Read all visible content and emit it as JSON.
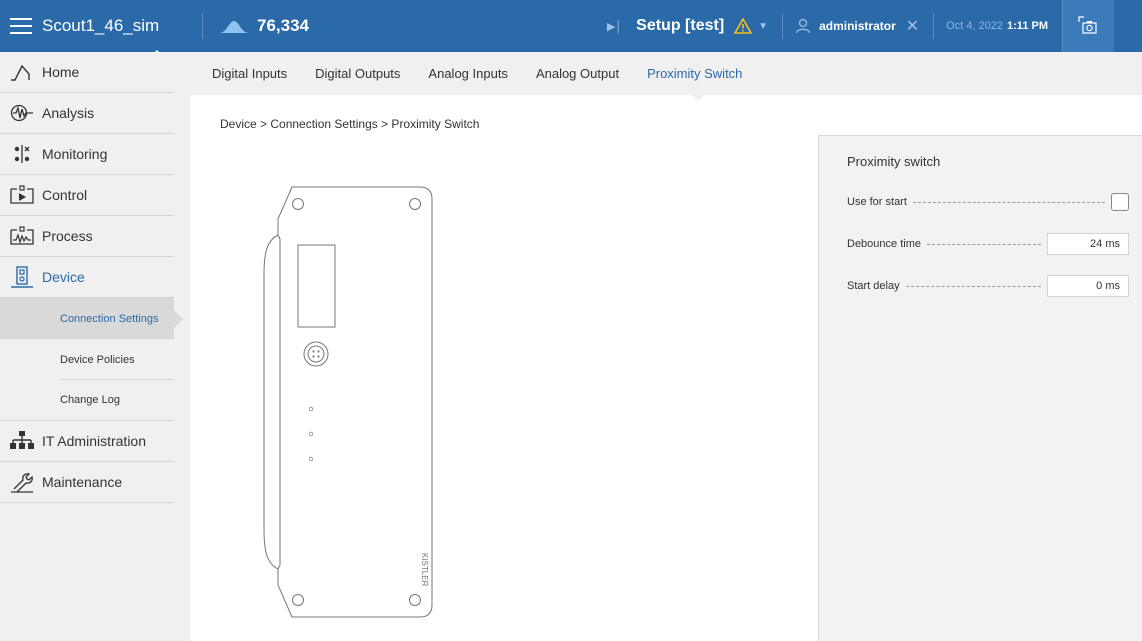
{
  "topbar": {
    "app_name": "Scout1_46_sim",
    "count": "76,334",
    "setup": "Setup [test]",
    "user": "administrator",
    "date": "Oct 4, 2022",
    "time": "1:11 PM",
    "colors": {
      "bar": "#2a6aa8",
      "warning": "#f5c218"
    }
  },
  "sidebar": {
    "items": [
      {
        "label": "Home",
        "icon": "home-icon"
      },
      {
        "label": "Analysis",
        "icon": "analysis-icon"
      },
      {
        "label": "Monitoring",
        "icon": "monitoring-icon"
      },
      {
        "label": "Control",
        "icon": "control-icon"
      },
      {
        "label": "Process",
        "icon": "process-icon"
      },
      {
        "label": "Device",
        "icon": "device-icon"
      },
      {
        "label": "IT Administration",
        "icon": "network-icon"
      },
      {
        "label": "Maintenance",
        "icon": "wrench-icon"
      }
    ],
    "device_sub": [
      "Connection Settings",
      "Device Policies",
      "Change Log"
    ],
    "active_item": "Device",
    "selected_sub": "Connection Settings"
  },
  "tabs": [
    "Digital Inputs",
    "Digital Outputs",
    "Analog Inputs",
    "Analog Output",
    "Proximity Switch"
  ],
  "active_tab": "Proximity Switch",
  "breadcrumb": "Device > Connection Settings > Proximity Switch",
  "device_label": "KISTLER",
  "panel": {
    "title": "Proximity switch",
    "use_for_start_label": "Use for start",
    "use_for_start_checked": false,
    "debounce_label": "Debounce time",
    "debounce_value": "24 ms",
    "start_delay_label": "Start delay",
    "start_delay_value": "0 ms"
  }
}
